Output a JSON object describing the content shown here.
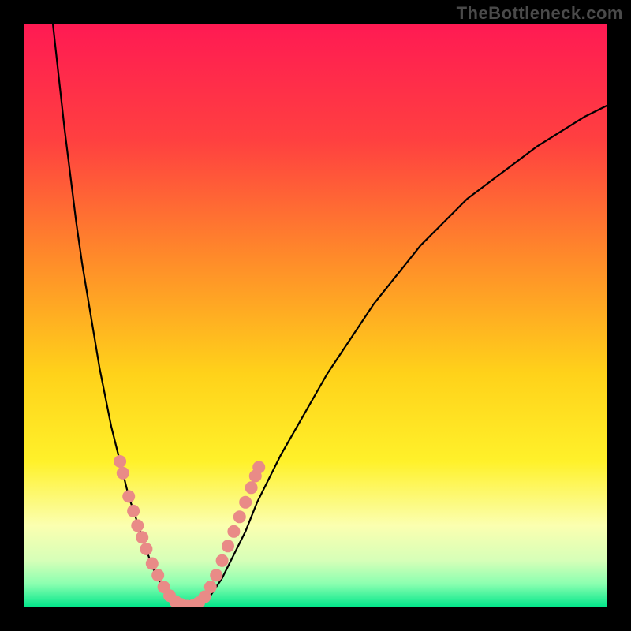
{
  "watermark": "TheBottleneck.com",
  "chart_data": {
    "type": "line",
    "title": "",
    "xlabel": "",
    "ylabel": "",
    "xlim": [
      0,
      100
    ],
    "ylim": [
      0,
      100
    ],
    "gradient_stops": [
      {
        "offset": 0.0,
        "color": "#ff1a53"
      },
      {
        "offset": 0.2,
        "color": "#ff4040"
      },
      {
        "offset": 0.4,
        "color": "#ff8a2a"
      },
      {
        "offset": 0.6,
        "color": "#ffd21a"
      },
      {
        "offset": 0.75,
        "color": "#fff12a"
      },
      {
        "offset": 0.86,
        "color": "#fbffb0"
      },
      {
        "offset": 0.92,
        "color": "#d6ffb8"
      },
      {
        "offset": 0.96,
        "color": "#8affb0"
      },
      {
        "offset": 1.0,
        "color": "#00e68a"
      }
    ],
    "series": [
      {
        "name": "curve",
        "x": [
          5,
          6,
          7,
          8,
          9,
          10,
          11,
          12,
          13,
          14,
          15,
          16,
          17,
          18,
          19,
          20,
          21,
          22,
          23,
          24,
          25,
          26,
          28,
          30,
          32,
          34,
          36,
          38,
          40,
          44,
          48,
          52,
          56,
          60,
          64,
          68,
          72,
          76,
          80,
          84,
          88,
          92,
          96,
          100
        ],
        "y": [
          100,
          91,
          82,
          74,
          66,
          59,
          53,
          47,
          41,
          36,
          31,
          27,
          23,
          19,
          16,
          13,
          10,
          7,
          5,
          3,
          2,
          1,
          0,
          0,
          2,
          5,
          9,
          13,
          18,
          26,
          33,
          40,
          46,
          52,
          57,
          62,
          66,
          70,
          73,
          76,
          79,
          81.5,
          84,
          86
        ]
      }
    ],
    "highlight_dots": {
      "color": "#e98b87",
      "points": [
        {
          "x": 16.5,
          "y": 25
        },
        {
          "x": 17.0,
          "y": 23
        },
        {
          "x": 18.0,
          "y": 19
        },
        {
          "x": 18.8,
          "y": 16.5
        },
        {
          "x": 19.5,
          "y": 14
        },
        {
          "x": 20.3,
          "y": 12
        },
        {
          "x": 21.0,
          "y": 10
        },
        {
          "x": 22.0,
          "y": 7.5
        },
        {
          "x": 23.0,
          "y": 5.5
        },
        {
          "x": 24.0,
          "y": 3.5
        },
        {
          "x": 25.0,
          "y": 2.0
        },
        {
          "x": 26.0,
          "y": 1.0
        },
        {
          "x": 27.0,
          "y": 0.5
        },
        {
          "x": 28.0,
          "y": 0.2
        },
        {
          "x": 29.0,
          "y": 0.3
        },
        {
          "x": 30.0,
          "y": 0.8
        },
        {
          "x": 31.0,
          "y": 1.8
        },
        {
          "x": 32.0,
          "y": 3.5
        },
        {
          "x": 33.0,
          "y": 5.5
        },
        {
          "x": 34.0,
          "y": 8.0
        },
        {
          "x": 35.0,
          "y": 10.5
        },
        {
          "x": 36.0,
          "y": 13.0
        },
        {
          "x": 37.0,
          "y": 15.5
        },
        {
          "x": 38.0,
          "y": 18.0
        },
        {
          "x": 39.0,
          "y": 20.5
        },
        {
          "x": 39.7,
          "y": 22.5
        },
        {
          "x": 40.3,
          "y": 24.0
        }
      ]
    }
  }
}
